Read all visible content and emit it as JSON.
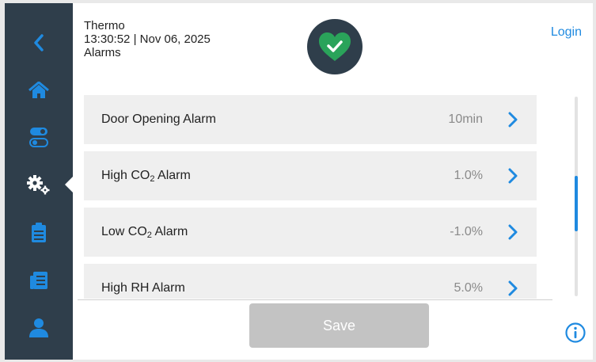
{
  "header": {
    "app_name": "Thermo",
    "time": "13:30:52",
    "separator": "|",
    "date": "Nov 06, 2025",
    "page_title": "Alarms",
    "login_label": "Login",
    "status": "ok"
  },
  "sidebar": {
    "items": [
      {
        "icon": "back-icon"
      },
      {
        "icon": "home-icon"
      },
      {
        "icon": "toggle-icon"
      },
      {
        "icon": "settings-icon",
        "active": true
      },
      {
        "icon": "clipboard-icon"
      },
      {
        "icon": "log-icon"
      },
      {
        "icon": "user-icon"
      }
    ]
  },
  "alarms": [
    {
      "label_main": "Door Opening Alarm",
      "label_sub": "",
      "label_suffix": "",
      "value": "10min"
    },
    {
      "label_main": "High CO",
      "label_sub": "2",
      "label_suffix": " Alarm",
      "value": "1.0%"
    },
    {
      "label_main": "Low CO",
      "label_sub": "2",
      "label_suffix": " Alarm",
      "value": "-1.0%"
    },
    {
      "label_main": "High RH Alarm",
      "label_sub": "",
      "label_suffix": "",
      "value": "5.0%"
    }
  ],
  "scroll": {
    "position_fraction": 0.55
  },
  "footer": {
    "save_label": "Save"
  },
  "colors": {
    "sidebar": "#2f3e4b",
    "accent": "#1f8ae0",
    "ok_green": "#2aa35a",
    "disabled_button": "#c3c3c3"
  }
}
